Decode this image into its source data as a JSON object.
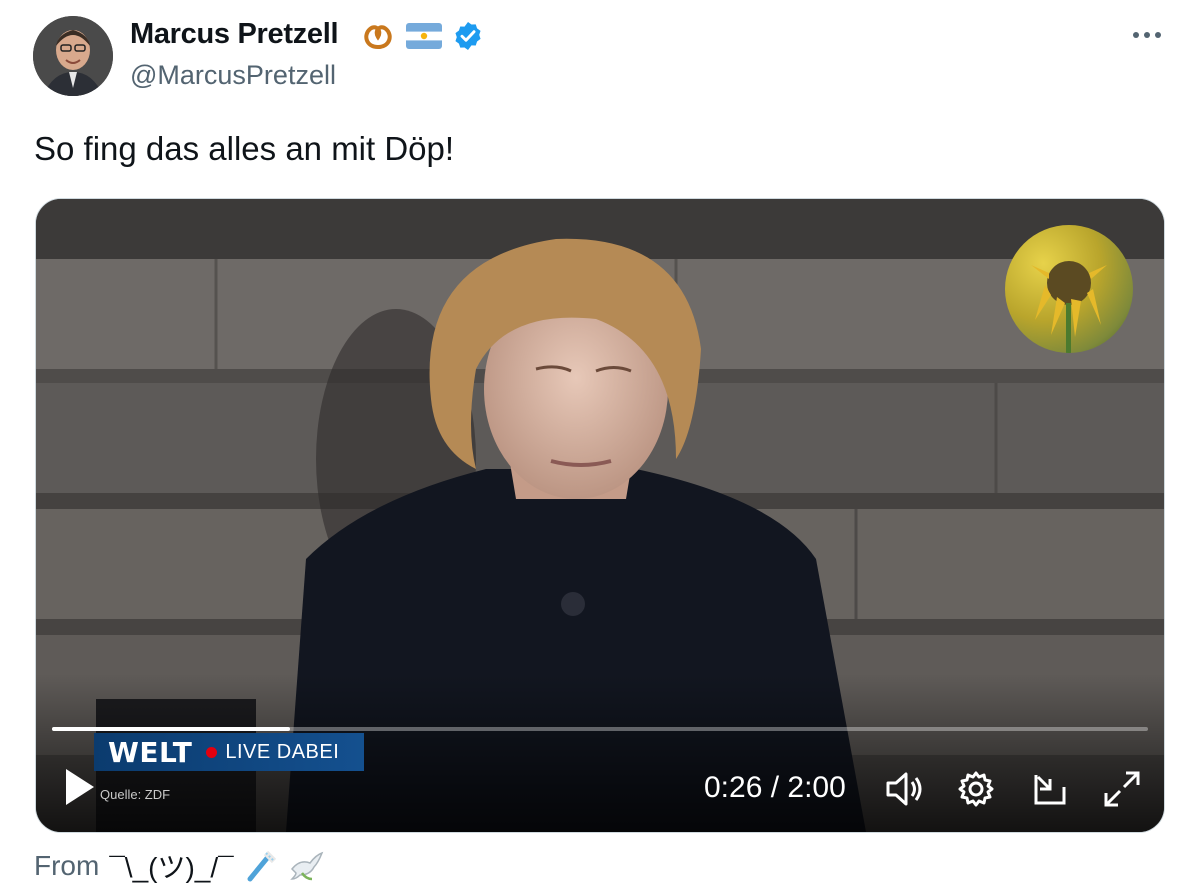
{
  "author": {
    "display_name": "Marcus Pretzell",
    "handle": "@MarcusPretzell"
  },
  "tweet": {
    "text": "So fing das alles an mit Döp!"
  },
  "video": {
    "brand": "WELT",
    "live_label": "LIVE DABEI",
    "source": "Quelle: ZDF",
    "current_time": "0:26",
    "duration": "2:00",
    "time_display": "0:26 / 2:00",
    "progress_fraction": 0.217
  },
  "footer": {
    "prefix": "From",
    "shrug": "¯\\_(ツ)_/¯"
  },
  "icons": {
    "more": "more-icon",
    "verified": "verified-badge-icon",
    "play": "play-icon",
    "volume": "volume-icon",
    "settings": "gear-icon",
    "pip": "picture-in-picture-icon",
    "fullscreen": "fullscreen-icon"
  },
  "colors": {
    "verified": "#1d9bf0",
    "handle": "#536471",
    "welt_blue": "#0b3b6e",
    "live_dot": "#e3000f"
  }
}
